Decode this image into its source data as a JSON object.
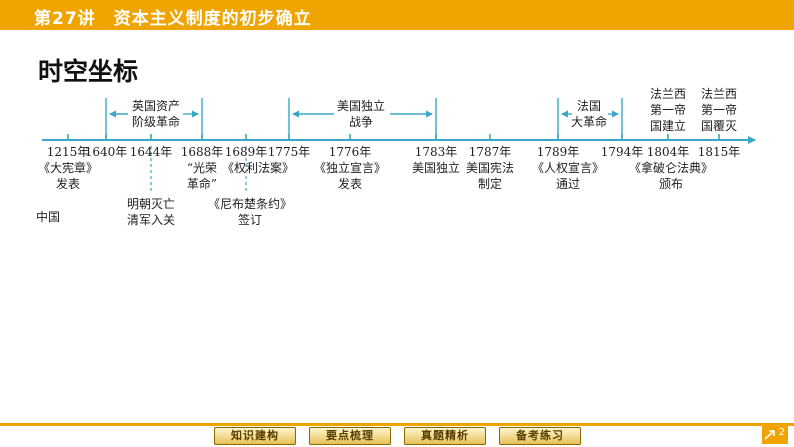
{
  "header": {
    "title": "第27讲　资本主义制度的初步确立",
    "color": "#f0a400"
  },
  "section_title": "时空坐标",
  "timeline": {
    "accent_color": "#3aa7c8",
    "spans": [
      {
        "label_lines": [
          "英国资产",
          "阶级革命"
        ]
      },
      {
        "label_lines": [
          "美国独立",
          "战争"
        ]
      },
      {
        "label_lines": [
          "法国",
          "大革命"
        ]
      }
    ],
    "top_events": [
      {
        "lines": [
          "法兰西",
          "第一帝",
          "国建立"
        ]
      },
      {
        "lines": [
          "法兰西",
          "第一帝",
          "国覆灭"
        ]
      }
    ],
    "years": [
      "1215年",
      "1640年",
      "1644年",
      "1688年",
      "1689年",
      "1775年",
      "1776年",
      "1783年",
      "1787年",
      "1789年",
      "1794年",
      "1804年",
      "1815年"
    ],
    "below_events": [
      {
        "lines": [
          "《大宪章》",
          "发表"
        ]
      },
      {
        "lines": [
          "“光荣",
          "革命”"
        ]
      },
      {
        "lines": [
          "《权利法案》"
        ]
      },
      {
        "lines": [
          "《独立宣言》",
          "发表"
        ]
      },
      {
        "lines": [
          "美国独立"
        ]
      },
      {
        "lines": [
          "美国宪法",
          "制定"
        ]
      },
      {
        "lines": [
          "《人权宣言》",
          "通过"
        ]
      },
      {
        "lines": [
          "《拿破仑法典》",
          "颁布"
        ]
      }
    ],
    "lower_events": [
      {
        "lines": [
          "明朝灭亡",
          "清军入关"
        ]
      },
      {
        "lines": [
          "《尼布楚条约》",
          "签订"
        ]
      }
    ],
    "china_label": "中国"
  },
  "footer": {
    "buttons": [
      "知识建构",
      "要点梳理",
      "真题精析",
      "备考练习"
    ],
    "page_number": "2"
  }
}
